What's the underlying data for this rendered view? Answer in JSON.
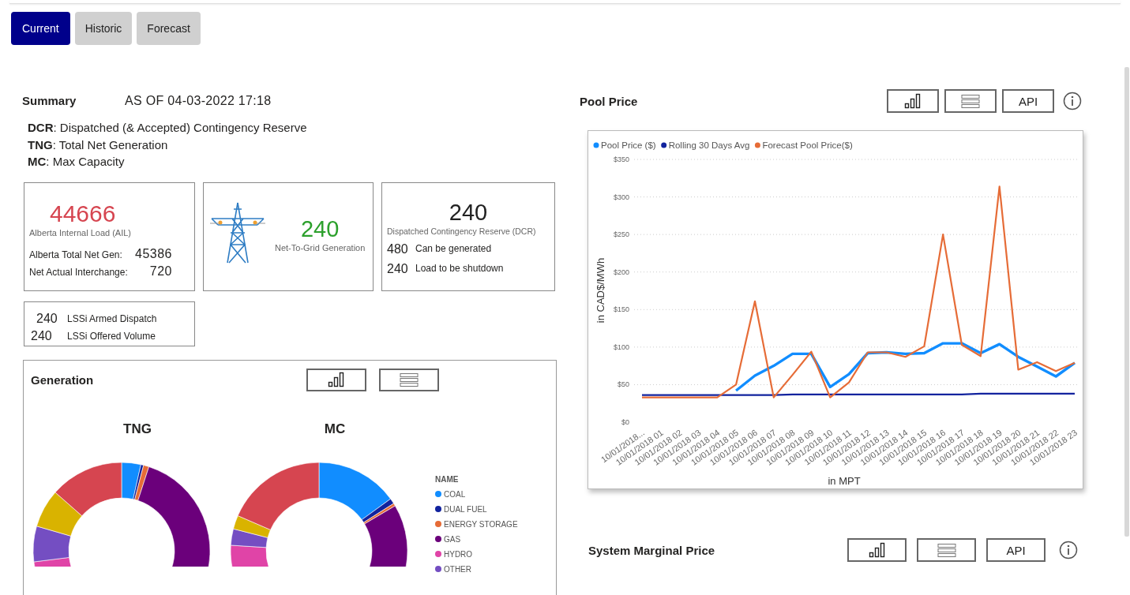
{
  "tabs": [
    {
      "label": "Current",
      "selected": true
    },
    {
      "label": "Historic",
      "selected": false
    },
    {
      "label": "Forecast",
      "selected": false
    }
  ],
  "summary": {
    "title": "Summary",
    "as_of": "AS OF 04-03-2022 17:18",
    "definitions": [
      "**DCR**: Dispatched (& Accepted) Contingency Reserve",
      "**TNG**: Total Net Generation",
      "**MC**:  Max Capacity"
    ]
  },
  "ail_card": {
    "value": "44666",
    "label": "Alberta Internal Load (AIL)",
    "rows": [
      {
        "label": "Alberta Total Net Gen:",
        "value": "45386"
      },
      {
        "label": "Net Actual Interchange:",
        "value": "720"
      }
    ]
  },
  "ntg_card": {
    "value": "240",
    "label": "Net-To-Grid Generation"
  },
  "dcr_card": {
    "value": "240",
    "label": "Dispatched Contingency Reserve (DCR)",
    "rows": [
      {
        "label": "Can be generated",
        "value": "480"
      },
      {
        "label": "Load to be shutdown",
        "value": "240"
      }
    ]
  },
  "lssi_card": {
    "rows": [
      {
        "value": "240",
        "label": "LSSi Armed Dispatch"
      },
      {
        "value": "240",
        "label": "LSSi Offered Volume"
      }
    ]
  },
  "generation": {
    "title": "Generation",
    "buttons": [
      {
        "kind": "chart"
      },
      {
        "kind": "table"
      }
    ],
    "charts": [
      {
        "title": "TNG"
      },
      {
        "title": "MC"
      }
    ],
    "legend": {
      "title": "NAME",
      "items": [
        {
          "label": "COAL",
          "color": "#118dff"
        },
        {
          "label": "DUAL FUEL",
          "color": "#12239e"
        },
        {
          "label": "ENERGY STORAGE",
          "color": "#e66c37"
        },
        {
          "label": "GAS",
          "color": "#6b007b"
        },
        {
          "label": "HYDRO",
          "color": "#e044a7"
        },
        {
          "label": "OTHER",
          "color": "#744ec2"
        }
      ]
    }
  },
  "pool_price": {
    "title": "Pool Price",
    "buttons": [
      {
        "kind": "chart"
      },
      {
        "kind": "table"
      },
      {
        "kind": "text",
        "label": "API"
      }
    ],
    "chart_data": {
      "type": "line",
      "xlabel": "in MPT",
      "ylabel": "in CAD$/MWh",
      "categories": [
        "10/01/2018...",
        "10/01/2018 01",
        "10/01/2018 02",
        "10/01/2018 03",
        "10/01/2018 04",
        "10/01/2018 05",
        "10/01/2018 06",
        "10/01/2018 07",
        "10/01/2018 08",
        "10/01/2018 09",
        "10/01/2018 10",
        "10/01/2018 11",
        "10/01/2018 12",
        "10/01/2018 13",
        "10/01/2018 14",
        "10/01/2018 15",
        "10/01/2018 16",
        "10/01/2018 17",
        "10/01/2018 18",
        "10/01/2018 19",
        "10/01/2018 20",
        "10/01/2018 21",
        "10/01/2018 22",
        "10/01/2018 23"
      ],
      "series": [
        {
          "name": "Pool Price ($)",
          "color": "#118dff",
          "values": [
            null,
            null,
            null,
            null,
            null,
            42,
            62,
            75,
            91,
            91,
            47,
            64,
            92,
            93,
            91,
            92,
            105,
            105,
            92,
            104,
            87,
            74,
            61,
            79
          ]
        },
        {
          "name": "Rolling 30 Days Avg",
          "color": "#12239e",
          "values": [
            36,
            36,
            36,
            36,
            36,
            36,
            36,
            36,
            37,
            37,
            37,
            37,
            37,
            37,
            37,
            37,
            37,
            37,
            38,
            38,
            38,
            38,
            38,
            38
          ]
        },
        {
          "name": "Forecast Pool Price($)",
          "color": "#e66c37",
          "values": [
            33,
            33,
            33,
            33,
            33,
            50,
            161,
            33,
            63,
            94,
            33,
            53,
            93,
            93,
            87,
            101,
            250,
            103,
            88,
            314,
            70,
            80,
            68,
            79
          ]
        }
      ],
      "ylim": [
        0,
        350
      ],
      "grid": true,
      "legend": true,
      "yticks": [
        {
          "value": 0,
          "label": "$0"
        },
        {
          "value": 50,
          "label": "$50"
        },
        {
          "value": 100,
          "label": "$100"
        },
        {
          "value": 150,
          "label": "$150"
        },
        {
          "value": 200,
          "label": "$200"
        },
        {
          "value": 250,
          "label": "$250"
        },
        {
          "value": 300,
          "label": "$300"
        },
        {
          "value": 350,
          "label": "$350"
        }
      ]
    }
  },
  "smp": {
    "title": "System Marginal Price",
    "buttons": [
      {
        "kind": "chart"
      },
      {
        "kind": "table"
      },
      {
        "kind": "text",
        "label": "API"
      }
    ]
  }
}
